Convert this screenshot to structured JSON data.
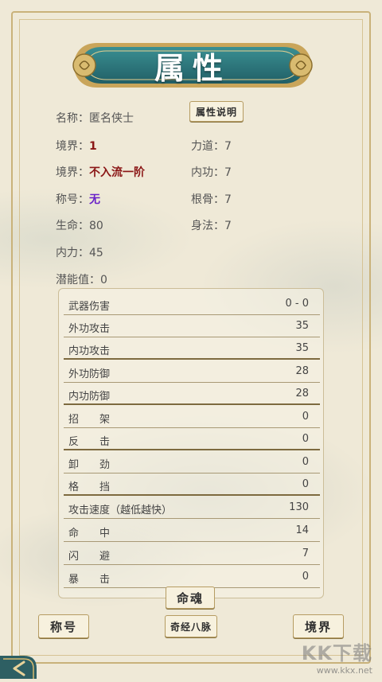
{
  "header": {
    "title": "属性"
  },
  "info_button": "属性说明",
  "stats_left": [
    {
      "key": "名称：",
      "value": "匿名侠士"
    },
    {
      "key": "境界：",
      "value": "1"
    },
    {
      "key": "境界：",
      "value": "不入流一阶"
    },
    {
      "key": "称号：",
      "value": "无"
    },
    {
      "key": "生命：",
      "value": "80"
    },
    {
      "key": "内力：",
      "value": "45"
    },
    {
      "key": "潜能值：",
      "value": "0"
    }
  ],
  "stats_right": [
    {
      "key": "力道：",
      "value": "7"
    },
    {
      "key": "内功：",
      "value": "7"
    },
    {
      "key": "根骨：",
      "value": "7"
    },
    {
      "key": "身法：",
      "value": "7"
    }
  ],
  "table": [
    {
      "label": "武器伤害",
      "value": "0 - 0"
    },
    {
      "label": "外功攻击",
      "value": "35"
    },
    {
      "label": "内功攻击",
      "value": "35"
    },
    {
      "label": "外功防御",
      "value": "28"
    },
    {
      "label": "内功防御",
      "value": "28"
    },
    {
      "label": "招　　架",
      "value": "0"
    },
    {
      "label": "反　　击",
      "value": "0"
    },
    {
      "label": "卸　　劲",
      "value": "0"
    },
    {
      "label": "格　　挡",
      "value": "0"
    },
    {
      "label": "攻击速度（越低越快）",
      "value": "130"
    },
    {
      "label": "命　　中",
      "value": "14"
    },
    {
      "label": "闪　　避",
      "value": "7"
    },
    {
      "label": "暴　　击",
      "value": "0"
    }
  ],
  "buttons": {
    "mingpo": "命魂",
    "title": "称号",
    "meridians": "奇经八脉",
    "realm": "境界"
  },
  "watermark": {
    "brand": "KK下载",
    "url": "www.kkx.net"
  },
  "colors": {
    "banner_teal": "#2f7d82",
    "gold": "#c9a55a",
    "red_value": "#8a1515",
    "purple_value": "#6a22c8"
  }
}
